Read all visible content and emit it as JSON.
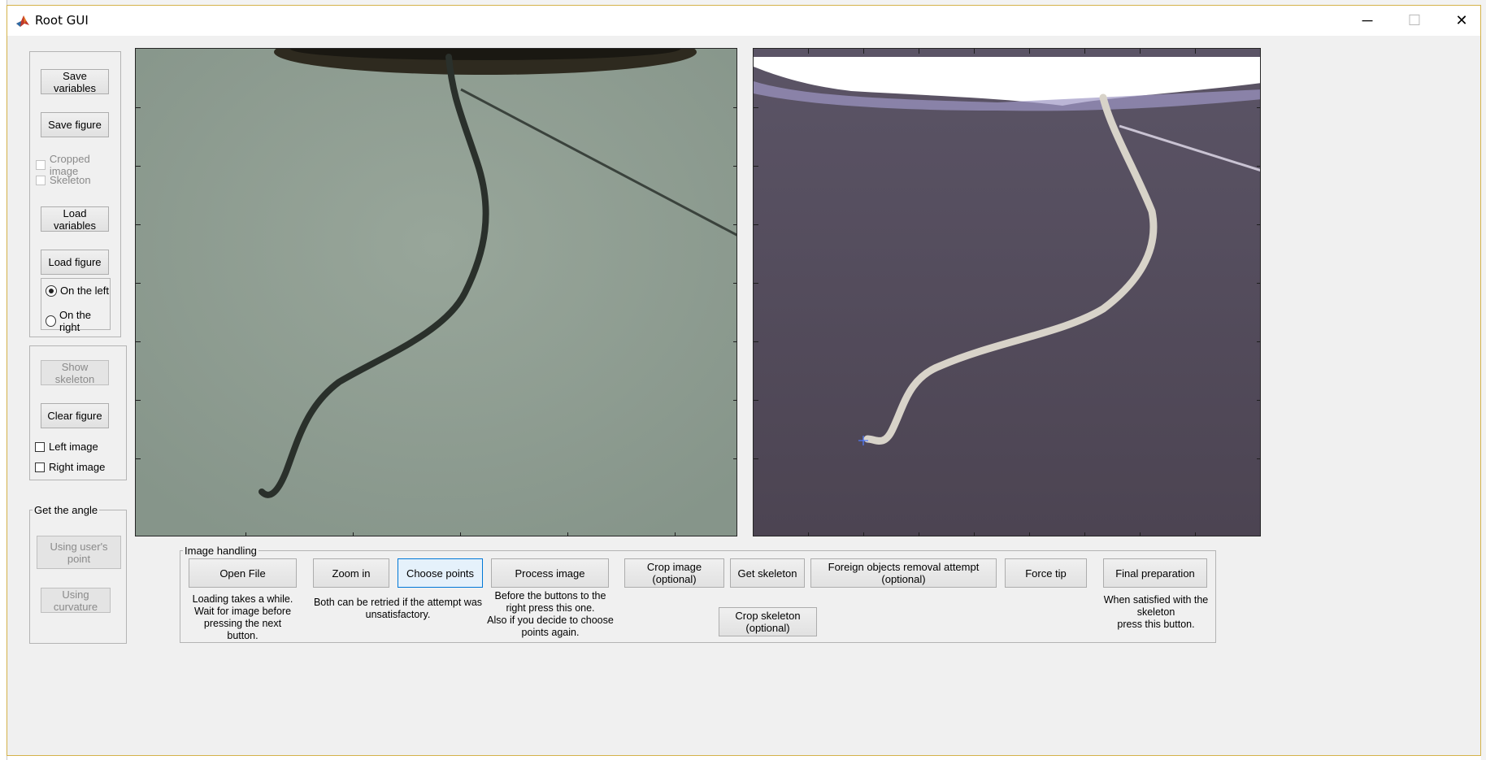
{
  "window": {
    "title": "Root GUI",
    "controls": {
      "minimize": "─",
      "maximize": "☐",
      "close": "✕"
    }
  },
  "left_panel": {
    "save_variables": "Save variables",
    "save_figure": "Save figure",
    "cropped_image": {
      "label": "Cropped image",
      "checked": false,
      "enabled": false
    },
    "skeleton": {
      "label": "Skeleton",
      "checked": false,
      "enabled": false
    },
    "load_variables": "Load variables",
    "load_figure": "Load figure",
    "position_options": [
      {
        "label": "On the left",
        "selected": true
      },
      {
        "label": "On the right",
        "selected": false
      }
    ]
  },
  "middle_panel": {
    "show_skeleton": "Show skeleton",
    "clear_figure": "Clear figure",
    "left_image": {
      "label": "Left image",
      "checked": false
    },
    "right_image": {
      "label": "Right image",
      "checked": false
    }
  },
  "angle_panel": {
    "title": "Get the angle",
    "using_users_point": "Using user's point",
    "using_curvature": "Using curvature"
  },
  "image_handling": {
    "title": "Image handling",
    "open_file": "Open File",
    "zoom_in": "Zoom in",
    "choose_points": "Choose points",
    "process_image": "Process image",
    "crop_image": "Crop image (optional)",
    "get_skeleton": "Get skeleton",
    "foreign_objects": "Foreign objects removal attempt (optional)",
    "force_tip": "Force tip",
    "final_preparation": "Final preparation",
    "crop_skeleton": "Crop skeleton (optional)",
    "note_open_file": "Loading takes a while.\nWait for  image before\npressing the next button.",
    "note_retry": "Both can be retried if the attempt was\nunsatisfactory.",
    "note_process": "Before the buttons to the\nright press this one.\nAlso if you decide to choose\npoints again.",
    "note_final": "When satisfied with the\nskeleton\npress this button."
  },
  "colors": {
    "window_bg": "#f0f0f0",
    "left_image_bg": "#8f9c90",
    "right_image_bg": "#4e4657",
    "focus_border": "#0078d7",
    "marker": "#4f7bff"
  }
}
